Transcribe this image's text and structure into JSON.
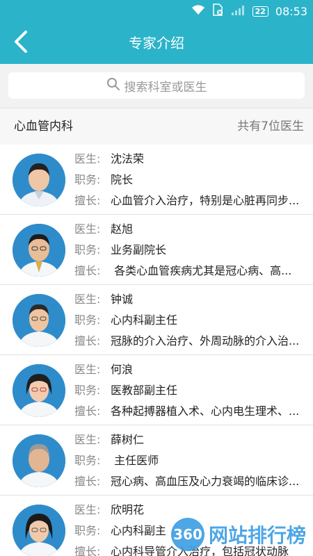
{
  "status_bar": {
    "battery": "22",
    "time": "08:53",
    "icons": [
      "wifi-icon",
      "no-sim-icon",
      "signal-icon",
      "battery-icon"
    ]
  },
  "app_bar": {
    "title": "专家介绍",
    "back_icon": "chevron-left-icon"
  },
  "search": {
    "placeholder": "搜索科室或医生",
    "icon": "search-icon"
  },
  "department": {
    "name": "心血管内科",
    "count_text": "共有7位医生"
  },
  "labels": {
    "doctor": "医生:",
    "position": "职务:",
    "specialty": "擅长:"
  },
  "doctors": [
    {
      "name": "沈法荣",
      "position": "院长",
      "specialty": "心血管介入治疗，特别是心脏再同步..."
    },
    {
      "name": "赵旭",
      "position": "业务副院长",
      "specialty": " 各类心血管疾病尤其是冠心病、高..."
    },
    {
      "name": "钟诚",
      "position": "心内科副主任",
      "specialty": "冠脉的介入治疗、外周动脉的介入治..."
    },
    {
      "name": "何浪",
      "position": "医教部副主任",
      "specialty": "各种起搏器植入术、心内电生理术、..."
    },
    {
      "name": "薛树仁",
      "position": "  主任医师",
      "specialty": "冠心病、高血压及心力衰竭的临床诊..."
    },
    {
      "name": "欣明花",
      "position": "心内科副主",
      "specialty": "心内科导管介入治疗，包括冠状动脉"
    }
  ],
  "watermark": {
    "logo_text": "360",
    "site_text": "网站排行榜"
  },
  "colors": {
    "primary": "#2bb3c9",
    "avatar_bg": "#2f8ccb",
    "label": "#888888",
    "text": "#222222"
  }
}
